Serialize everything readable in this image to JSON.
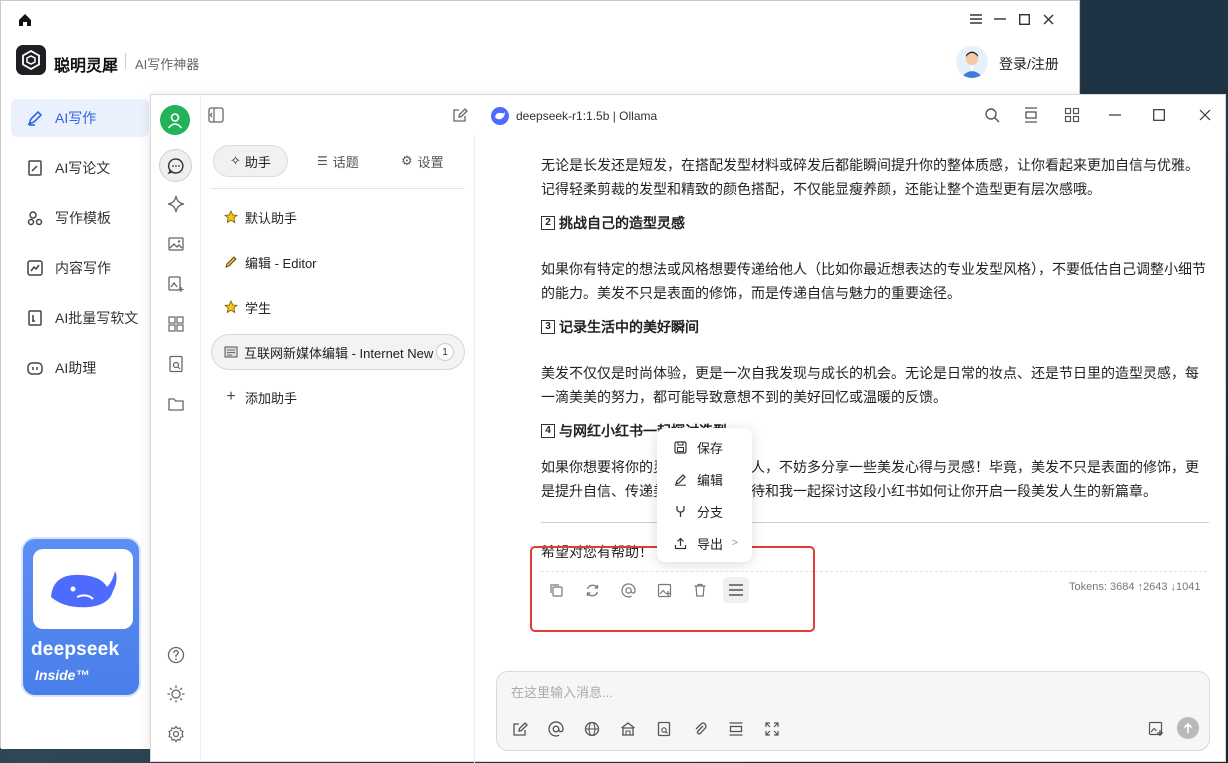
{
  "outer_window": {
    "brand_name": "聪明灵犀",
    "brand_tagline": "AI写作神器",
    "login_label": "登录/注册"
  },
  "sidebar": {
    "items": [
      {
        "label": "AI写作",
        "icon": "pen-icon",
        "active": true
      },
      {
        "label": "AI写论文",
        "icon": "paper-icon",
        "active": false
      },
      {
        "label": "写作模板",
        "icon": "template-icon",
        "active": false
      },
      {
        "label": "内容写作",
        "icon": "chart-icon",
        "active": false
      },
      {
        "label": "AI批量写软文",
        "icon": "batch-icon",
        "active": false
      },
      {
        "label": "AI助理",
        "icon": "robot-icon",
        "active": false
      }
    ],
    "promo": {
      "word": "deepseek",
      "sub": "Inside™"
    }
  },
  "chat_window": {
    "model_title": "deepseek-r1:1.5b | Ollama",
    "tabs": [
      {
        "label": "助手",
        "icon": "sparkle-icon",
        "active": true
      },
      {
        "label": "话题",
        "icon": "list-icon",
        "active": false
      },
      {
        "label": "设置",
        "icon": "gear-icon",
        "active": false
      }
    ],
    "assistants": [
      {
        "label": "默认助手",
        "icon": "⭐"
      },
      {
        "label": "编辑 - Editor",
        "icon": "✏️"
      },
      {
        "label": "学生",
        "icon": "⭐"
      },
      {
        "label": "互联网新媒体编辑 - Internet New",
        "icon": "📰",
        "badge": "1",
        "active": true
      }
    ],
    "add_assistant": "添加助手"
  },
  "message": {
    "para1": "无论是长发还是短发，在搭配发型材料或碎发后都能瞬间提升你的整体质感，让你看起来更加自信与优雅。记得轻柔剪裁的发型和精致的颜色搭配，不仅能显瘦养颜，还能让整个造型更有层次感哦。",
    "h2_num": "2",
    "h2": "挑战自己的造型灵感",
    "para2": "如果你有特定的想法或风格想要传递给他人（比如你最近想表达的专业发型风格），不要低估自己调整小细节的能力。美发不只是表面的修饰，而是传递自信与魅力的重要途径。",
    "h3_num": "3",
    "h3": "记录生活中的美好瞬间",
    "para3": "美发不仅仅是时尚体验，更是一次自我发现与成长的机会。无论是日常的妆点、还是节日里的造型灵感，每一滴美美的努力，都可能导致意想不到的美好回忆或温暖的反馈。",
    "h4_num": "4",
    "h4": "与网红小红书一起探讨造型",
    "para4": "如果你想要将你的灵感分享给更多人，不妨多分享一些美发心得与灵感！毕竟，美发不只是表面的修饰，更是提升自信、传递美好的方式。期待和我一起探讨这段小红书如何让你开启一段美发人生的新篇章。",
    "closing": "希望对您有帮助！",
    "tokens": "Tokens: 3684 ↑2643 ↓1041"
  },
  "context_menu": {
    "items": [
      {
        "label": "保存",
        "icon": "save-icon"
      },
      {
        "label": "编辑",
        "icon": "edit-icon"
      },
      {
        "label": "分支",
        "icon": "branch-icon"
      },
      {
        "label": "导出",
        "icon": "export-icon",
        "submenu": true
      }
    ]
  },
  "composer": {
    "placeholder": "在这里输入消息..."
  },
  "colors": {
    "accent": "#2f64e6",
    "highlight_box": "#e23b31",
    "avatar_green": "#21b25a"
  }
}
